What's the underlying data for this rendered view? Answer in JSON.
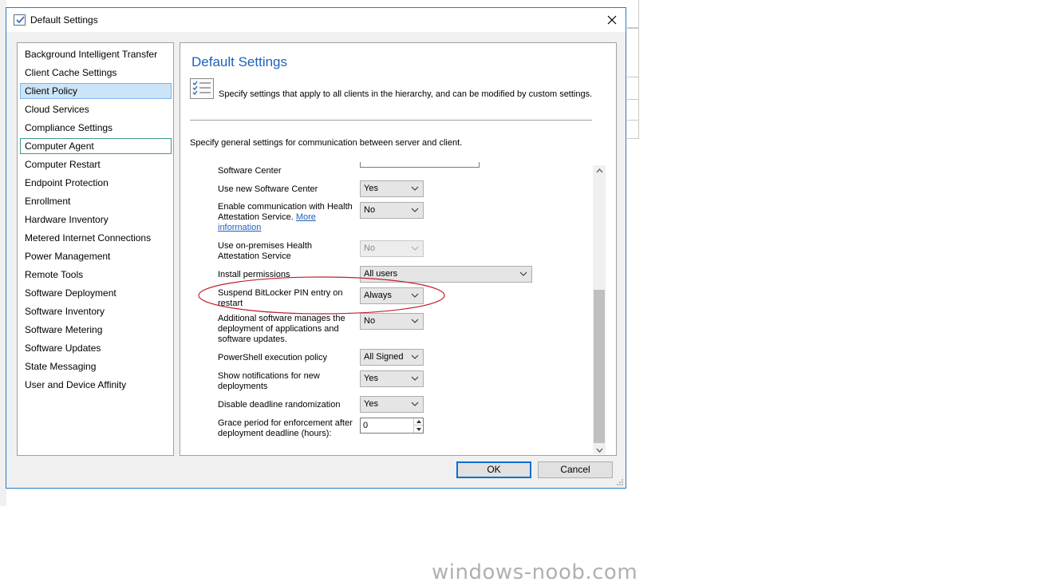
{
  "window": {
    "title": "Default Settings",
    "close_glyph": "✕"
  },
  "nav": {
    "items": [
      {
        "label": "Background Intelligent Transfer"
      },
      {
        "label": "Client Cache Settings"
      },
      {
        "label": "Client Policy",
        "selected": true
      },
      {
        "label": "Cloud Services"
      },
      {
        "label": "Compliance Settings"
      },
      {
        "label": "Computer Agent",
        "focused": true
      },
      {
        "label": "Computer Restart"
      },
      {
        "label": "Endpoint Protection"
      },
      {
        "label": "Enrollment"
      },
      {
        "label": "Hardware Inventory"
      },
      {
        "label": "Metered Internet Connections"
      },
      {
        "label": "Power Management"
      },
      {
        "label": "Remote Tools"
      },
      {
        "label": "Software Deployment"
      },
      {
        "label": "Software Inventory"
      },
      {
        "label": "Software Metering"
      },
      {
        "label": "Software Updates"
      },
      {
        "label": "State Messaging"
      },
      {
        "label": "User and Device Affinity"
      }
    ]
  },
  "content": {
    "title": "Default Settings",
    "description": "Specify settings that apply to all clients in the hierarchy, and can be modified by custom settings.",
    "section_description": "Specify general settings for communication between server and client.",
    "settings": {
      "software_center": {
        "label": "Software Center"
      },
      "use_new_software_center": {
        "label": "Use new Software Center",
        "value": "Yes"
      },
      "health_attestation": {
        "label": "Enable communication with Health Attestation Service.",
        "link": "More information",
        "value": "No"
      },
      "on_prem_health": {
        "label": "Use on-premises Health Attestation Service",
        "value": "No"
      },
      "install_permissions": {
        "label": "Install permissions",
        "value": "All users"
      },
      "suspend_bitlocker": {
        "label": "Suspend BitLocker PIN entry on restart",
        "value": "Always"
      },
      "additional_software": {
        "label": "Additional software manages the deployment of applications and software updates.",
        "value": "No"
      },
      "powershell_policy": {
        "label": "PowerShell execution policy",
        "value": "All Signed"
      },
      "show_notifications": {
        "label": "Show notifications for new deployments",
        "value": "Yes"
      },
      "deadline_randomization": {
        "label": "Disable deadline randomization",
        "value": "Yes"
      },
      "grace_period": {
        "label": "Grace period for enforcement after deployment deadline (hours):",
        "value": "0"
      }
    }
  },
  "buttons": {
    "ok": "OK",
    "cancel": "Cancel"
  },
  "watermark": "windows-noob.com",
  "colors": {
    "accent": "#1e62b8",
    "annotation": "#c0202a",
    "selection": "#cce4f7"
  }
}
